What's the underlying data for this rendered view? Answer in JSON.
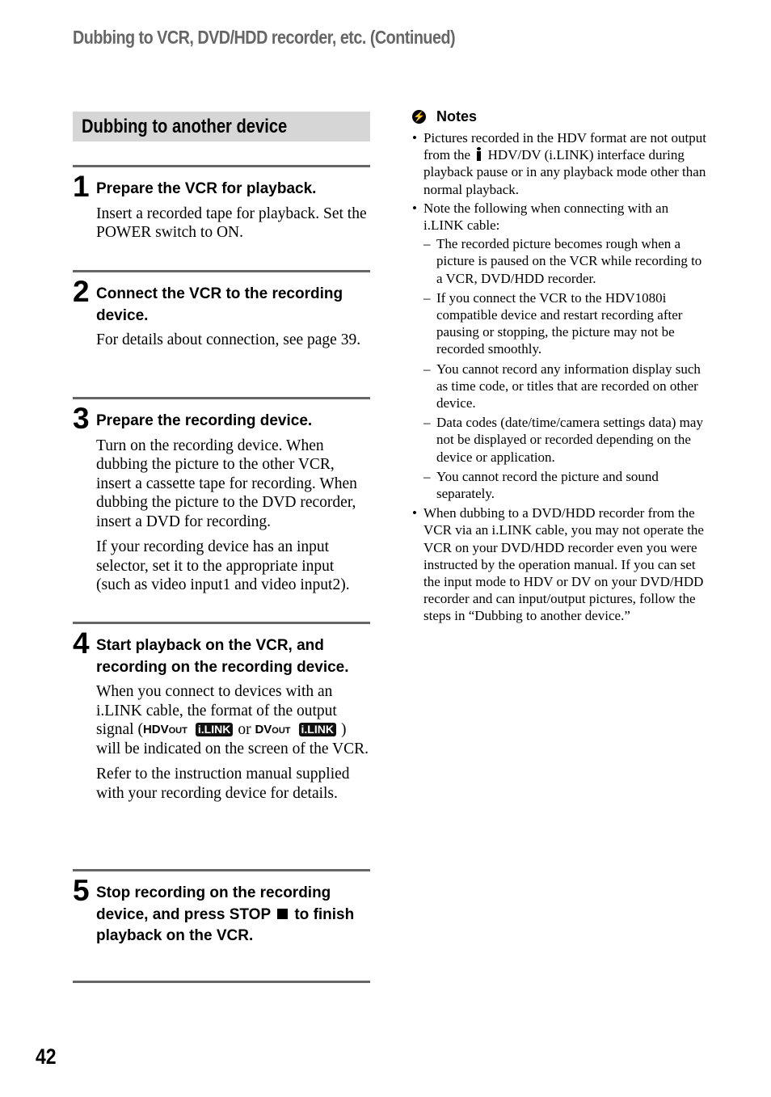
{
  "running_head": "Dubbing to VCR, DVD/HDD recorder, etc. (Continued)",
  "section_title": "Dubbing to another device",
  "steps": [
    {
      "number": "1",
      "heading": "Prepare the VCR for playback.",
      "paragraphs": [
        "Insert a recorded tape for playback. Set the POWER switch to ON."
      ]
    },
    {
      "number": "2",
      "heading": "Connect the VCR to the recording device.",
      "paragraphs": [
        "For details about connection, see page 39."
      ]
    },
    {
      "number": "3",
      "heading": "Prepare the recording device.",
      "paragraphs": [
        "Turn on the recording device. When dubbing the picture to the other VCR, insert a cassette tape for recording. When dubbing the picture to the DVD recorder, insert a DVD for recording.",
        "If your recording device has an input selector, set it to the appropriate input (such as video input1 and video input2)."
      ]
    },
    {
      "number": "4",
      "heading": "Start playback on the VCR, and recording on the recording device.",
      "p1_before": "When you connect to devices with an i.LINK cable, the format of the output signal (",
      "indicator_hdv_main": "HDV",
      "indicator_hdv_small": "OUT",
      "ilink_badge": "i.LINK",
      "or_text": "or",
      "indicator_dv_main": "DV",
      "indicator_dv_small": "OUT",
      "p1_after": ") will be indicated on the screen of the VCR.",
      "p2": "Refer to the instruction manual supplied with your recording device for details."
    },
    {
      "number": "5",
      "heading_before": "Stop recording on the recording device, and press STOP",
      "heading_after": "to finish playback on the VCR."
    }
  ],
  "notes": {
    "heading": "Notes",
    "icon": "notes-warning-icon",
    "item1_before": "Pictures recorded in the HDV format are not output from the",
    "item1_after": "HDV/DV (i.LINK) interface during playback pause or in any playback mode other than normal playback.",
    "item2": "Note the following when connecting with an i.LINK cable:",
    "item2_sub": [
      "The recorded picture becomes rough when a picture is paused on the VCR while recording to a VCR, DVD/HDD recorder.",
      "If you connect the VCR to the HDV1080i compatible device and restart recording after pausing or stopping, the picture may not be recorded smoothly.",
      "You cannot record any information display such as time code, or titles that are recorded on other device.",
      "Data codes (date/time/camera settings data) may not be displayed or recorded depending on the device or application.",
      "You cannot record the picture and sound separately."
    ],
    "item3": "When dubbing to a DVD/HDD recorder from the VCR via an i.LINK cable, you may not operate the VCR on your DVD/HDD recorder even you were instructed by the operation manual. If you can set the input mode to HDV or DV on your DVD/HDD recorder and can input/output pictures, follow the steps in “Dubbing to another device.”"
  },
  "page_number": "42"
}
